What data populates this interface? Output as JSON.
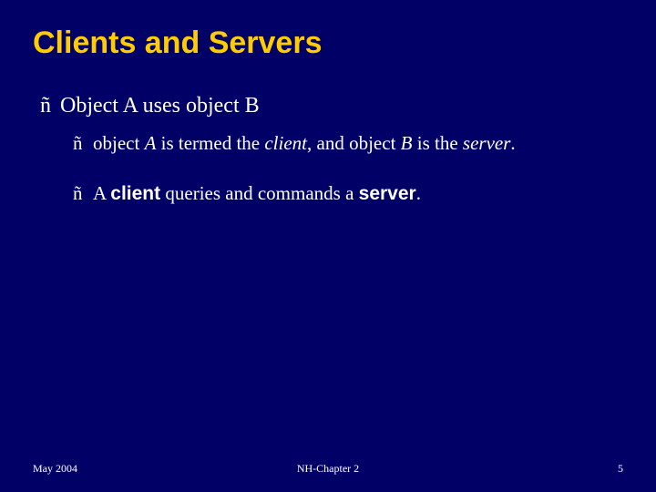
{
  "slide": {
    "title": "Clients and Servers",
    "bullet_mark": "ñ",
    "bullets": {
      "l1": {
        "text": "Object A uses object B"
      },
      "l2a": {
        "p1": "object ",
        "p2": "A",
        "p3": " is termed the ",
        "p4": "client",
        "p5": ", and object ",
        "p6": "B",
        "p7": " is the ",
        "p8": "server",
        "p9": "."
      },
      "l2b": {
        "p1": "A ",
        "p2": "client",
        "p3": " queries and commands a ",
        "p4": "server",
        "p5": "."
      }
    }
  },
  "footer": {
    "date": "May 2004",
    "center": "NH-Chapter 2",
    "page": "5"
  }
}
